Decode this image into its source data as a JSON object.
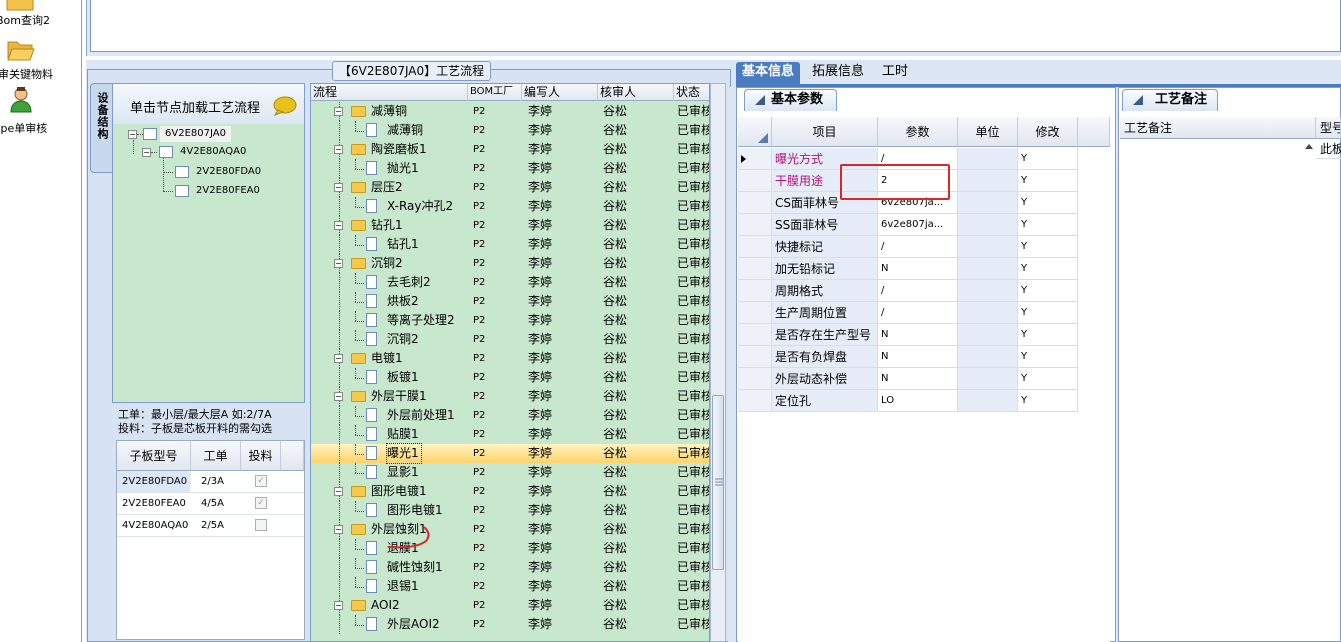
{
  "launcher": {
    "items": [
      {
        "label": "Bom查询2",
        "icon": "folder-icon"
      },
      {
        "label": "审关键物料",
        "icon": "folder-open-icon"
      },
      {
        "label": "ype单审核",
        "icon": "user-icon"
      }
    ]
  },
  "left_group": {
    "title": "【6V2E807JA0】工艺流程",
    "vertical_tab": "设备结构",
    "tree_header": "单击节点加载工艺流程",
    "tree": [
      {
        "label": "6V2E807JA0",
        "level": 0
      },
      {
        "label": "4V2E80AQA0",
        "level": 1
      },
      {
        "label": "2V2E80FDA0",
        "level": 2
      },
      {
        "label": "2V2E80FEA0",
        "level": 2
      }
    ],
    "info_line1": "工单：最小层/最大层A 如:2/7A",
    "info_line2": "投料：子板是芯板开料的需勾选",
    "sub_table": {
      "headers": [
        "子板型号",
        "工单",
        "投料"
      ],
      "rows": [
        {
          "model": "2V2E80FDA0",
          "order": "2/3A",
          "checked": true
        },
        {
          "model": "2V2E80FEA0",
          "order": "4/5A",
          "checked": true
        },
        {
          "model": "4V2E80AQA0",
          "order": "2/5A",
          "checked": false
        }
      ]
    }
  },
  "process_grid": {
    "headers": [
      "流程",
      "BOM工厂",
      "编写人",
      "核审人",
      "状态"
    ],
    "rows": [
      {
        "name": "减薄铜",
        "type": "folder",
        "factory": "P2",
        "writer": "李婷",
        "reviewer": "谷松",
        "status": "已审核"
      },
      {
        "name": "减薄铜",
        "type": "item",
        "factory": "P2",
        "writer": "李婷",
        "reviewer": "谷松",
        "status": "已审核"
      },
      {
        "name": "陶瓷磨板1",
        "type": "folder",
        "factory": "P2",
        "writer": "李婷",
        "reviewer": "谷松",
        "status": "已审核"
      },
      {
        "name": "抛光1",
        "type": "item",
        "factory": "P2",
        "writer": "李婷",
        "reviewer": "谷松",
        "status": "已审核"
      },
      {
        "name": "层压2",
        "type": "folder",
        "factory": "P2",
        "writer": "李婷",
        "reviewer": "谷松",
        "status": "已审核"
      },
      {
        "name": "X-Ray冲孔2",
        "type": "item",
        "factory": "P2",
        "writer": "李婷",
        "reviewer": "谷松",
        "status": "已审核"
      },
      {
        "name": "钻孔1",
        "type": "folder",
        "factory": "P2",
        "writer": "李婷",
        "reviewer": "谷松",
        "status": "已审核"
      },
      {
        "name": "钻孔1",
        "type": "item",
        "factory": "P2",
        "writer": "李婷",
        "reviewer": "谷松",
        "status": "已审核"
      },
      {
        "name": "沉铜2",
        "type": "folder",
        "factory": "P2",
        "writer": "李婷",
        "reviewer": "谷松",
        "status": "已审核"
      },
      {
        "name": "去毛刺2",
        "type": "item",
        "factory": "P2",
        "writer": "李婷",
        "reviewer": "谷松",
        "status": "已审核"
      },
      {
        "name": "烘板2",
        "type": "item",
        "factory": "P2",
        "writer": "李婷",
        "reviewer": "谷松",
        "status": "已审核"
      },
      {
        "name": "等离子处理2",
        "type": "item",
        "factory": "P2",
        "writer": "李婷",
        "reviewer": "谷松",
        "status": "已审核"
      },
      {
        "name": "沉铜2",
        "type": "item",
        "factory": "P2",
        "writer": "李婷",
        "reviewer": "谷松",
        "status": "已审核"
      },
      {
        "name": "电镀1",
        "type": "folder",
        "factory": "P2",
        "writer": "李婷",
        "reviewer": "谷松",
        "status": "已审核"
      },
      {
        "name": "板镀1",
        "type": "item",
        "factory": "P2",
        "writer": "李婷",
        "reviewer": "谷松",
        "status": "已审核"
      },
      {
        "name": "外层干膜1",
        "type": "folder",
        "factory": "P2",
        "writer": "李婷",
        "reviewer": "谷松",
        "status": "已审核"
      },
      {
        "name": "外层前处理1",
        "type": "item",
        "factory": "P2",
        "writer": "李婷",
        "reviewer": "谷松",
        "status": "已审核"
      },
      {
        "name": "贴膜1",
        "type": "item",
        "factory": "P2",
        "writer": "李婷",
        "reviewer": "谷松",
        "status": "已审核"
      },
      {
        "name": "曝光1",
        "type": "item",
        "factory": "P2",
        "writer": "李婷",
        "reviewer": "谷松",
        "status": "已审核",
        "selected": true
      },
      {
        "name": "显影1",
        "type": "item",
        "factory": "P2",
        "writer": "李婷",
        "reviewer": "谷松",
        "status": "已审核"
      },
      {
        "name": "图形电镀1",
        "type": "folder",
        "factory": "P2",
        "writer": "李婷",
        "reviewer": "谷松",
        "status": "已审核"
      },
      {
        "name": "图形电镀1",
        "type": "item",
        "factory": "P2",
        "writer": "李婷",
        "reviewer": "谷松",
        "status": "已审核"
      },
      {
        "name": "外层蚀刻1",
        "type": "folder",
        "factory": "P2",
        "writer": "李婷",
        "reviewer": "谷松",
        "status": "已审核"
      },
      {
        "name": "退膜1",
        "type": "item",
        "factory": "P2",
        "writer": "李婷",
        "reviewer": "谷松",
        "status": "已审核"
      },
      {
        "name": "碱性蚀刻1",
        "type": "item",
        "factory": "P2",
        "writer": "李婷",
        "reviewer": "谷松",
        "status": "已审核"
      },
      {
        "name": "退锡1",
        "type": "item",
        "factory": "P2",
        "writer": "李婷",
        "reviewer": "谷松",
        "status": "已审核"
      },
      {
        "name": "AOI2",
        "type": "folder",
        "factory": "P2",
        "writer": "李婷",
        "reviewer": "谷松",
        "status": "已审核"
      },
      {
        "name": "外层AOI2",
        "type": "item",
        "factory": "P2",
        "writer": "李婷",
        "reviewer": "谷松",
        "status": "已审核"
      }
    ]
  },
  "right_tabs": [
    "基本信息",
    "拓展信息",
    "工时"
  ],
  "basic_params": {
    "tab_label": "基本参数",
    "headers": [
      "项目",
      "参数",
      "单位",
      "修改"
    ],
    "rows": [
      {
        "item": "曝光方式",
        "param": "/",
        "unit": "",
        "edit": "Y",
        "highlight": true,
        "current": true
      },
      {
        "item": "干膜用途",
        "param": "2",
        "unit": "",
        "edit": "Y",
        "highlight": true
      },
      {
        "item": "CS面菲林号",
        "param": "6v2e807ja...",
        "unit": "",
        "edit": "Y"
      },
      {
        "item": "SS面菲林号",
        "param": "6v2e807ja...",
        "unit": "",
        "edit": "Y"
      },
      {
        "item": "快捷标记",
        "param": "/",
        "unit": "",
        "edit": "Y"
      },
      {
        "item": "加无铅标记",
        "param": "N",
        "unit": "",
        "edit": "Y"
      },
      {
        "item": "周期格式",
        "param": "/",
        "unit": "",
        "edit": "Y"
      },
      {
        "item": "生产周期位置",
        "param": "/",
        "unit": "",
        "edit": "Y"
      },
      {
        "item": "是否存在生产型号",
        "param": "N",
        "unit": "",
        "edit": "Y"
      },
      {
        "item": "是否有负焊盘",
        "param": "N",
        "unit": "",
        "edit": "Y"
      },
      {
        "item": "外层动态补偿",
        "param": "N",
        "unit": "",
        "edit": "Y"
      },
      {
        "item": "定位孔",
        "param": "LO",
        "unit": "",
        "edit": "Y"
      }
    ]
  },
  "notes": {
    "tab_label": "工艺备注",
    "headers": [
      "工艺备注",
      "型号"
    ],
    "cell": "此板"
  },
  "colors": {
    "grid_green": "#c7e8cd",
    "selected_row": "#ffd36b",
    "highlight_text": "#b0127a",
    "annotation_red": "#d8262b",
    "tab_active": "#4a7cc0"
  }
}
